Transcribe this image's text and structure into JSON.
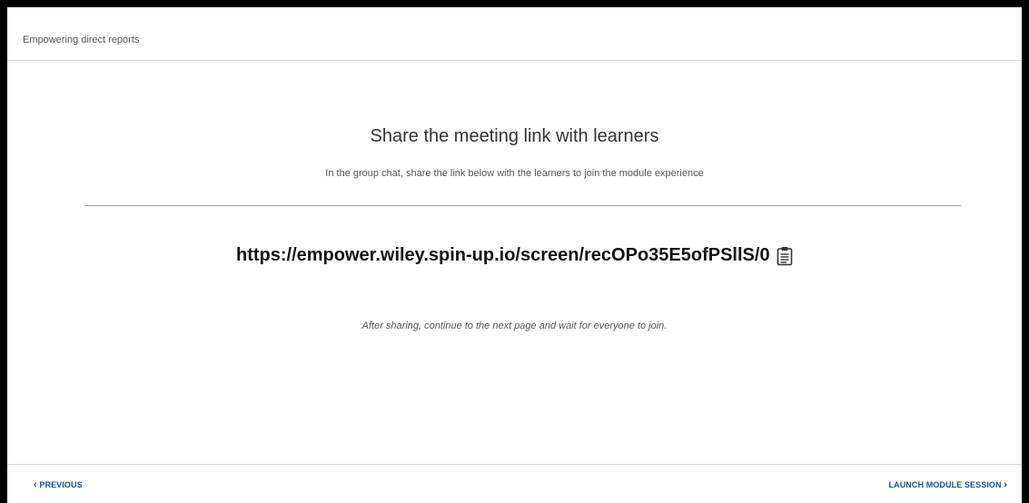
{
  "header": {
    "title": "Empowering direct reports"
  },
  "main": {
    "title": "Share the meeting link with learners",
    "subtitle": "In the group chat, share the link below with the learners to join the module experience",
    "meeting_link": "https://empower.wiley.spin-up.io/screen/recOPo35E5ofPSllS/0",
    "copy_icon": "clipboard-icon",
    "instruction": "After sharing, continue to the next page and wait for everyone to join."
  },
  "footer": {
    "previous_label": "PREVIOUS",
    "launch_label": "LAUNCH MODULE SESSION",
    "prev_icon": "chevron-left-icon",
    "next_icon": "chevron-right-icon"
  },
  "colors": {
    "accent": "#1f4e8c",
    "background": "#ffffff",
    "frame": "#000000"
  }
}
